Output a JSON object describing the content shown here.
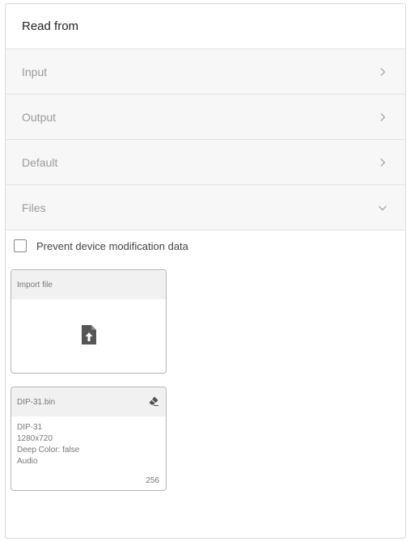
{
  "panel": {
    "title": "Read from"
  },
  "sections": [
    {
      "label": "Input",
      "state": "collapsed",
      "icon": "chevron-right-icon"
    },
    {
      "label": "Output",
      "state": "collapsed",
      "icon": "chevron-right-icon"
    },
    {
      "label": "Default",
      "state": "collapsed",
      "icon": "chevron-right-icon"
    },
    {
      "label": "Files",
      "state": "expanded",
      "icon": "chevron-down-icon"
    }
  ],
  "files": {
    "prevent_checkbox": {
      "label": "Prevent device modification data",
      "checked": false
    },
    "import_card": {
      "title": "Import file",
      "icon": "file-upload-icon"
    },
    "file_card": {
      "name": "DIP-31.bin",
      "icon": "eraser-icon",
      "lines": [
        "DIP-31",
        "1280x720",
        "Deep Color: false",
        "Audio"
      ],
      "count": "256"
    }
  },
  "colors": {
    "section_bg": "#f7f7f7",
    "border": "#d9d9d9",
    "icon_dark": "#555555"
  }
}
